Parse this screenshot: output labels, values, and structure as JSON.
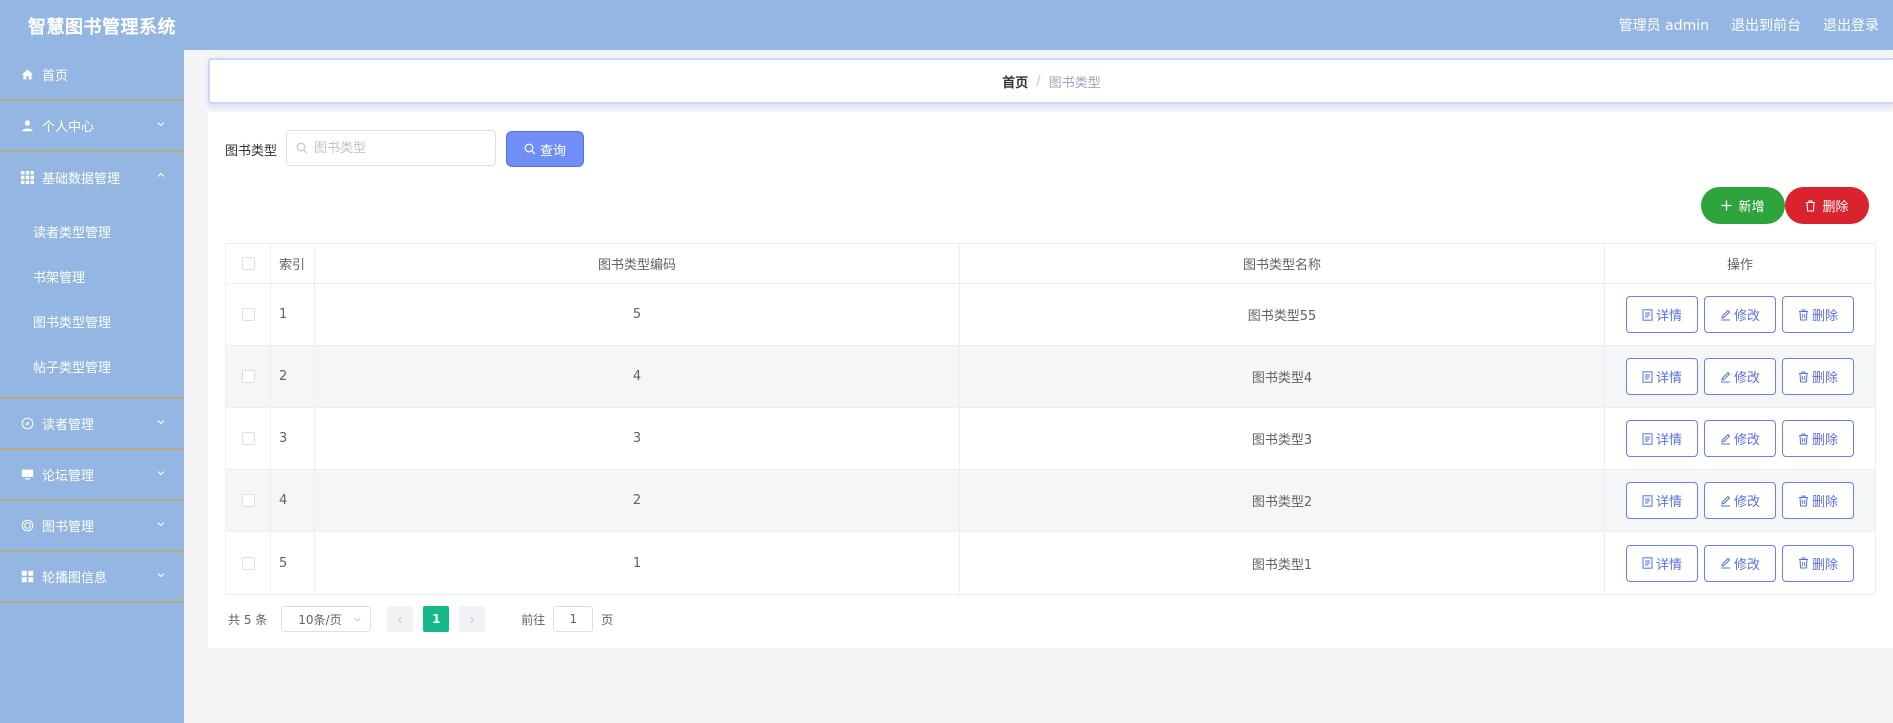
{
  "header": {
    "title": "智慧图书管理系统",
    "admin_label": "管理员 admin",
    "back_label": "退出到前台",
    "logout_label": "退出登录"
  },
  "sidebar": {
    "items": [
      {
        "label": "首页",
        "icon": "home-icon"
      },
      {
        "label": "个人中心",
        "icon": "user-icon"
      },
      {
        "label": "基础数据管理",
        "icon": "grid-icon"
      },
      {
        "label": "读者管理",
        "icon": "compass-icon"
      },
      {
        "label": "论坛管理",
        "icon": "monitor-icon"
      },
      {
        "label": "图书管理",
        "icon": "target-icon"
      },
      {
        "label": "轮播图信息",
        "icon": "apps-icon"
      }
    ],
    "sub_items": [
      "读者类型管理",
      "书架管理",
      "图书类型管理",
      "帖子类型管理"
    ]
  },
  "breadcrumb": {
    "home": "首页",
    "separator": "/",
    "current": "图书类型"
  },
  "search": {
    "label": "图书类型",
    "placeholder": "图书类型",
    "value": "",
    "button": "查询"
  },
  "actions": {
    "add": "新增",
    "delete": "删除"
  },
  "table": {
    "headers": [
      "索引",
      "图书类型编码",
      "图书类型名称",
      "操作"
    ],
    "rows": [
      {
        "index": "1",
        "code": "5",
        "name": "图书类型55"
      },
      {
        "index": "2",
        "code": "4",
        "name": "图书类型4"
      },
      {
        "index": "3",
        "code": "3",
        "name": "图书类型3"
      },
      {
        "index": "4",
        "code": "2",
        "name": "图书类型2"
      },
      {
        "index": "5",
        "code": "1",
        "name": "图书类型1"
      }
    ],
    "op_labels": {
      "detail": "详情",
      "edit": "修改",
      "delete": "删除"
    }
  },
  "pagination": {
    "total": "共 5 条",
    "page_size": "10条/页",
    "current": "1",
    "goto_prefix": "前往",
    "goto_value": "1",
    "goto_suffix": "页"
  },
  "colors": {
    "header_bg": "#94b6e3",
    "query_btn": "#6f8ff7",
    "add_btn": "#2ea43c",
    "delete_btn": "#d9232f",
    "active_page": "#16b98a"
  }
}
